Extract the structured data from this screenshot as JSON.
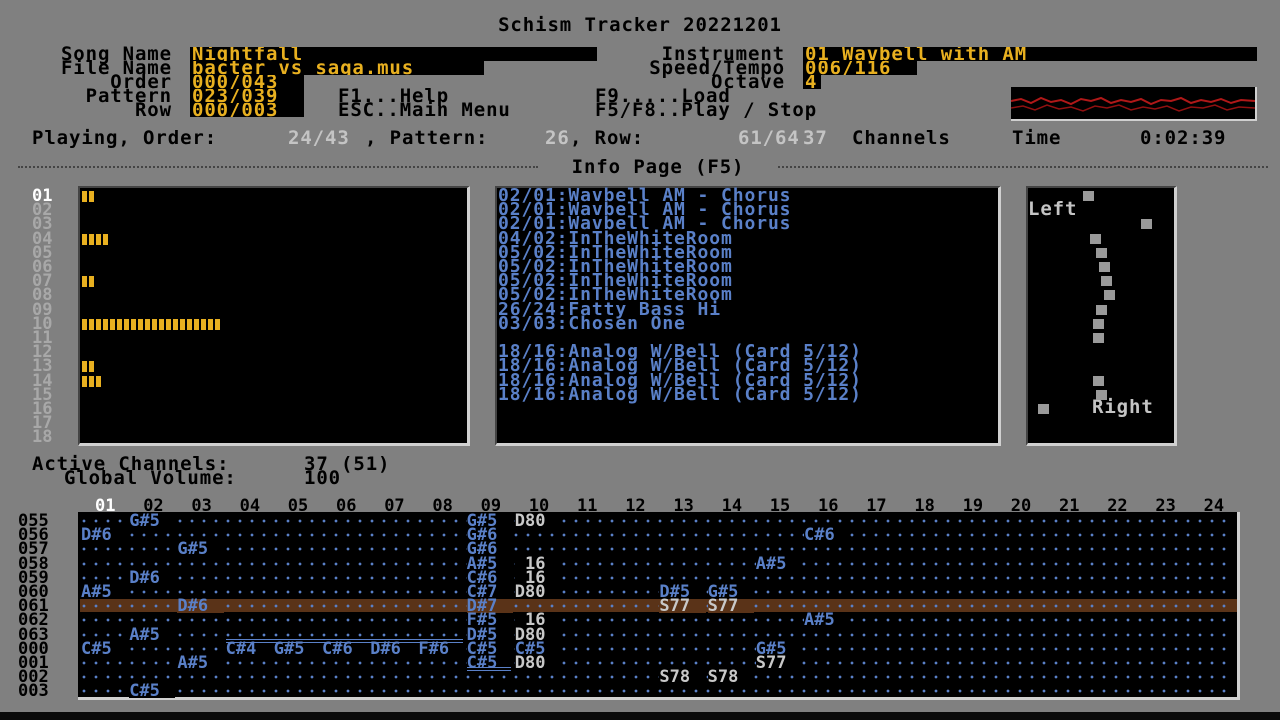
{
  "app": {
    "title": "Schism Tracker 20221201"
  },
  "header": {
    "song_name_label": "Song Name",
    "song_name": "Nightfall",
    "file_name_label": "File Name",
    "file_name": "bacter_vs_saga.mus",
    "order_label": "Order",
    "order_value": "000/043",
    "pattern_label": "Pattern",
    "pattern_value": "023/039",
    "row_label": "Row",
    "row_value": "000/003",
    "instrument_label": "Instrument",
    "instrument_value": "01 Wavbell with AM",
    "speed_label": "Speed/Tempo",
    "speed_value": "006/116",
    "octave_label": "Octave",
    "octave_value": "4",
    "help_hint": "F1...Help",
    "menu_hint": "ESC..Main Menu",
    "load_hint": "F9.....Load",
    "play_hint": "F5/F8..Play / Stop"
  },
  "status": {
    "playing_label": "Playing, Order:",
    "order": "24/43",
    "pattern_label": ", Pattern:",
    "pattern": "26",
    "row_label": ", Row:",
    "row": "61/64",
    "channels": "37",
    "channels_label": "Channels",
    "time_label": "Time",
    "time": "0:02:39"
  },
  "info_page_title": "Info Page (F5)",
  "channels_list": [
    {
      "num": "01",
      "bar": 2,
      "active": true
    },
    {
      "num": "02",
      "bar": 0,
      "active": false
    },
    {
      "num": "03",
      "bar": 0,
      "active": false
    },
    {
      "num": "04",
      "bar": 4,
      "active": false
    },
    {
      "num": "05",
      "bar": 0,
      "active": false
    },
    {
      "num": "06",
      "bar": 0,
      "active": false
    },
    {
      "num": "07",
      "bar": 2,
      "active": false
    },
    {
      "num": "08",
      "bar": 0,
      "active": false
    },
    {
      "num": "09",
      "bar": 0,
      "active": false
    },
    {
      "num": "10",
      "bar": 20,
      "active": false
    },
    {
      "num": "11",
      "bar": 0,
      "active": false
    },
    {
      "num": "12",
      "bar": 0,
      "active": false
    },
    {
      "num": "13",
      "bar": 2,
      "active": false
    },
    {
      "num": "14",
      "bar": 3,
      "active": false
    },
    {
      "num": "15",
      "bar": 0,
      "active": false
    },
    {
      "num": "16",
      "bar": 0,
      "active": false
    },
    {
      "num": "17",
      "bar": 0,
      "active": false
    },
    {
      "num": "18",
      "bar": 0,
      "active": false
    }
  ],
  "samples_list": [
    "02/01:Wavbell AM - Chorus",
    "02/01:Wavbell AM - Chorus",
    "02/01:Wavbell AM - Chorus",
    "04/02:InTheWhiteRoom",
    "05/02:InTheWhiteRoom",
    "05/02:InTheWhiteRoom",
    "05/02:InTheWhiteRoom",
    "05/02:InTheWhiteRoom",
    "26/24:Fatty Bass Hi",
    "03/03:Chosen One",
    "",
    "18/16:Analog W/Bell (Card 5/12)",
    "18/16:Analog W/Bell (Card 5/12)",
    "18/16:Analog W/Bell (Card 5/12)",
    "18/16:Analog W/Bell (Card 5/12)"
  ],
  "panning": {
    "left_label": "Left",
    "right_label": "Right",
    "rows": [
      0.4,
      0,
      0.85,
      0.45,
      0.5,
      0.52,
      0.54,
      0.56,
      0.5,
      0.48,
      0.48,
      0,
      0,
      0.48,
      0.5,
      0.05
    ]
  },
  "active_channels_label": "Active Channels:",
  "active_channels": "37 (51)",
  "global_volume_label": "Global Volume:",
  "global_volume": "100",
  "pattern": {
    "channel_headers": [
      "01",
      "02",
      "03",
      "04",
      "05",
      "06",
      "07",
      "08",
      "09",
      "10",
      "11",
      "12",
      "13",
      "14",
      "15",
      "16",
      "17",
      "18",
      "19",
      "20",
      "21",
      "22",
      "23",
      "24"
    ],
    "rows": [
      "055",
      "056",
      "057",
      "058",
      "059",
      "060",
      "061",
      "062",
      "063",
      "000",
      "001",
      "002",
      "003"
    ],
    "current_row_index": 6,
    "cells": [
      {
        "r": 0,
        "c": 1,
        "t": "G#5",
        "k": "note"
      },
      {
        "r": 0,
        "c": 8,
        "t": "G#5",
        "k": "note"
      },
      {
        "r": 0,
        "c": 9,
        "t": "D80",
        "k": "cmd"
      },
      {
        "r": 1,
        "c": 0,
        "t": "D#6",
        "k": "note"
      },
      {
        "r": 1,
        "c": 8,
        "t": "G#6",
        "k": "note"
      },
      {
        "r": 1,
        "c": 15,
        "t": "C#6",
        "k": "note"
      },
      {
        "r": 2,
        "c": 2,
        "t": "G#5",
        "k": "note"
      },
      {
        "r": 2,
        "c": 8,
        "t": "G#6",
        "k": "note"
      },
      {
        "r": 3,
        "c": 8,
        "t": "A#5",
        "k": "note"
      },
      {
        "r": 3,
        "c": 9,
        "t": " 16",
        "k": "cmd"
      },
      {
        "r": 3,
        "c": 14,
        "t": "A#5",
        "k": "note"
      },
      {
        "r": 4,
        "c": 1,
        "t": "D#6",
        "k": "note"
      },
      {
        "r": 4,
        "c": 8,
        "t": "C#6",
        "k": "note"
      },
      {
        "r": 4,
        "c": 9,
        "t": " 16",
        "k": "cmd"
      },
      {
        "r": 5,
        "c": 0,
        "t": "A#5",
        "k": "note"
      },
      {
        "r": 5,
        "c": 8,
        "t": "C#7",
        "k": "note"
      },
      {
        "r": 5,
        "c": 9,
        "t": "D80",
        "k": "cmd"
      },
      {
        "r": 5,
        "c": 12,
        "t": "D#5",
        "k": "note"
      },
      {
        "r": 5,
        "c": 13,
        "t": "G#5",
        "k": "note"
      },
      {
        "r": 6,
        "c": 2,
        "t": "D#6",
        "k": "note"
      },
      {
        "r": 6,
        "c": 8,
        "t": "D#7",
        "k": "note"
      },
      {
        "r": 6,
        "c": 12,
        "t": "S77",
        "k": "cmd"
      },
      {
        "r": 6,
        "c": 13,
        "t": "S77",
        "k": "cmd"
      },
      {
        "r": 7,
        "c": 8,
        "t": "F#5",
        "k": "note"
      },
      {
        "r": 7,
        "c": 9,
        "t": " 16",
        "k": "cmd"
      },
      {
        "r": 7,
        "c": 15,
        "t": "A#5",
        "k": "note"
      },
      {
        "r": 8,
        "c": 1,
        "t": "A#5",
        "k": "note"
      },
      {
        "r": 8,
        "c": 8,
        "t": "D#5",
        "k": "note"
      },
      {
        "r": 8,
        "c": 9,
        "t": "D80",
        "k": "cmd"
      },
      {
        "r": 9,
        "c": 0,
        "t": "C#5",
        "k": "note"
      },
      {
        "r": 9,
        "c": 3,
        "t": "C#4",
        "k": "note"
      },
      {
        "r": 9,
        "c": 4,
        "t": "G#5",
        "k": "note"
      },
      {
        "r": 9,
        "c": 5,
        "t": "C#6",
        "k": "note"
      },
      {
        "r": 9,
        "c": 6,
        "t": "D#6",
        "k": "note"
      },
      {
        "r": 9,
        "c": 7,
        "t": "F#6",
        "k": "note"
      },
      {
        "r": 9,
        "c": 8,
        "t": "C#5",
        "k": "note"
      },
      {
        "r": 9,
        "c": 9,
        "t": "C#5",
        "k": "note"
      },
      {
        "r": 9,
        "c": 14,
        "t": "G#5",
        "k": "note"
      },
      {
        "r": 10,
        "c": 2,
        "t": "A#5",
        "k": "note"
      },
      {
        "r": 10,
        "c": 8,
        "t": "C#5",
        "k": "note"
      },
      {
        "r": 10,
        "c": 9,
        "t": "D80",
        "k": "cmd"
      },
      {
        "r": 10,
        "c": 14,
        "t": "S77",
        "k": "cmd"
      },
      {
        "r": 11,
        "c": 12,
        "t": "S78",
        "k": "cmd"
      },
      {
        "r": 11,
        "c": 13,
        "t": "S78",
        "k": "cmd"
      },
      {
        "r": 12,
        "c": 1,
        "t": "C#5",
        "k": "note"
      }
    ]
  },
  "colors": {
    "background": "#808080",
    "highlight_yellow": "#e8b020",
    "note_blue": "#5a80c8",
    "current_row": "#5a3318"
  }
}
